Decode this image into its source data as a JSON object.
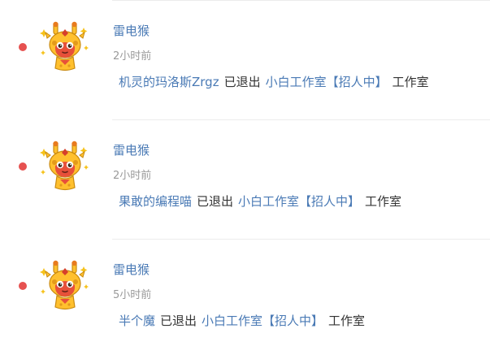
{
  "colors": {
    "link": "#4a7ab5",
    "text": "#333333",
    "muted": "#9a9a9a",
    "unread_dot": "#e65150",
    "divider": "#ececec"
  },
  "notifications": [
    {
      "unread": true,
      "avatar_icon": "giraffe-avatar-icon",
      "username": "雷电猴",
      "time": "2小时前",
      "member": "机灵的玛洛斯Zrgz",
      "action": "已退出",
      "studio": "小白工作室【招人中】",
      "studio_type": "工作室"
    },
    {
      "unread": true,
      "avatar_icon": "giraffe-avatar-icon",
      "username": "雷电猴",
      "time": "2小时前",
      "member": "果敢的编程喵",
      "action": "已退出",
      "studio": "小白工作室【招人中】",
      "studio_type": "工作室"
    },
    {
      "unread": true,
      "avatar_icon": "giraffe-avatar-icon",
      "username": "雷电猴",
      "time": "5小时前",
      "member": "半个魔",
      "action": "已退出",
      "studio": "小白工作室【招人中】",
      "studio_type": "工作室"
    }
  ]
}
